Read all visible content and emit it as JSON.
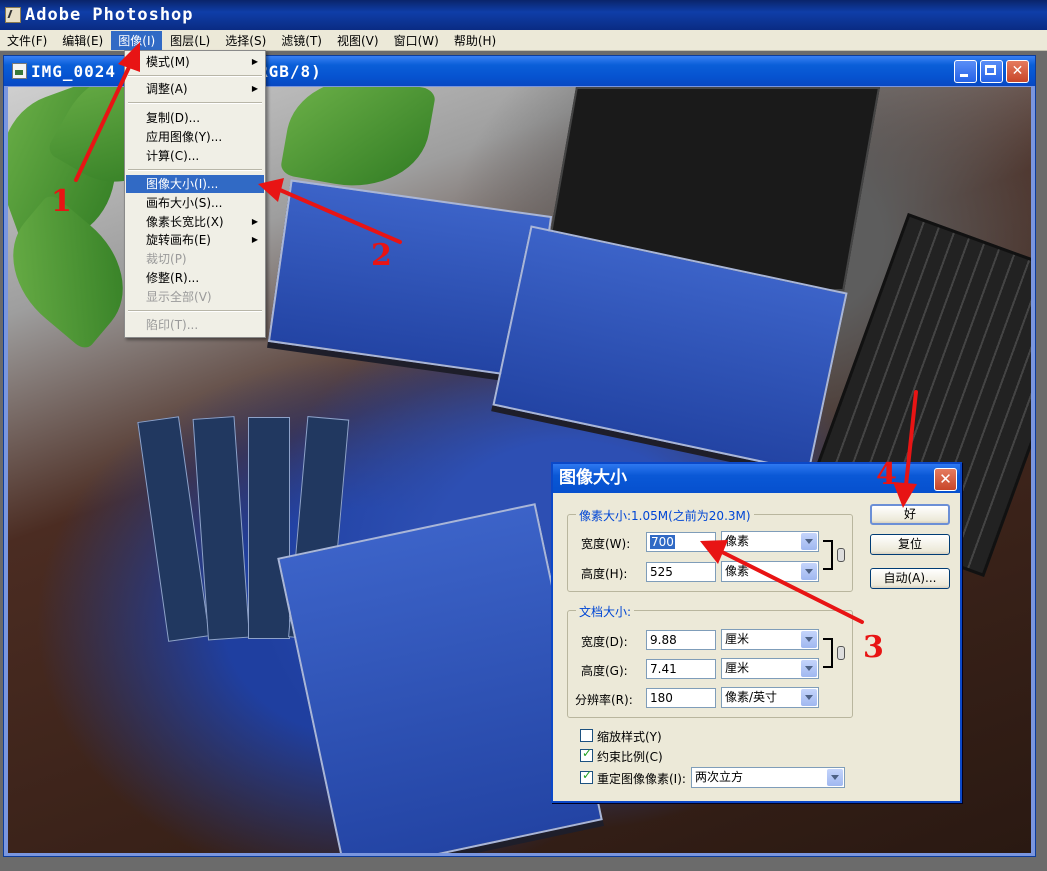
{
  "app": {
    "title": "Adobe Photoshop"
  },
  "menubar": {
    "items": [
      {
        "label": "文件",
        "key": "(F)"
      },
      {
        "label": "编辑",
        "key": "(E)"
      },
      {
        "label": "图像",
        "key": "(I)"
      },
      {
        "label": "图层",
        "key": "(L)"
      },
      {
        "label": "选择",
        "key": "(S)"
      },
      {
        "label": "滤镜",
        "key": "(T)"
      },
      {
        "label": "视图",
        "key": "(V)"
      },
      {
        "label": "窗口",
        "key": "(W)"
      },
      {
        "label": "帮助",
        "key": "(H)"
      }
    ]
  },
  "document": {
    "title_left": "IMG_0024",
    "title_right": "RGB/8)"
  },
  "image_menu": {
    "items": [
      {
        "label": "模式",
        "key": "(M)",
        "submenu": true
      },
      {
        "label": "调整",
        "key": "(A)",
        "submenu": true
      },
      {
        "label": "复制",
        "key": "(D)..."
      },
      {
        "label": "应用图像",
        "key": "(Y)..."
      },
      {
        "label": "计算",
        "key": "(C)..."
      },
      {
        "label": "图像大小",
        "key": "(I)...",
        "highlighted": true
      },
      {
        "label": "画布大小",
        "key": "(S)..."
      },
      {
        "label": "像素长宽比",
        "key": "(X)",
        "submenu": true
      },
      {
        "label": "旋转画布",
        "key": "(E)",
        "submenu": true
      },
      {
        "label": "裁切",
        "key": "(P)",
        "disabled": true
      },
      {
        "label": "修整",
        "key": "(R)..."
      },
      {
        "label": "显示全部",
        "key": "(V)",
        "disabled": true
      },
      {
        "label": "陷印",
        "key": "(T)...",
        "disabled": true
      }
    ]
  },
  "dialog": {
    "title": "图像大小",
    "pixel_group": "像素大小:1.05M(之前为20.3M)",
    "doc_group": "文档大小:",
    "pixel_width_label": "宽度(W):",
    "pixel_width_value": "700",
    "pixel_width_unit": "像素",
    "pixel_height_label": "高度(H):",
    "pixel_height_value": "525",
    "pixel_height_unit": "像素",
    "doc_width_label": "宽度(D):",
    "doc_width_value": "9.88",
    "doc_width_unit": "厘米",
    "doc_height_label": "高度(G):",
    "doc_height_value": "7.41",
    "doc_height_unit": "厘米",
    "resolution_label": "分辨率(R):",
    "resolution_value": "180",
    "resolution_unit": "像素/英寸",
    "scale_styles_label": "缩放样式(Y)",
    "constrain_label": "约束比例(C)",
    "resample_label": "重定图像像素(I):",
    "resample_value": "两次立方",
    "ok_label": "好",
    "reset_label": "复位",
    "auto_label": "自动(A)..."
  },
  "annotations": [
    "1",
    "2",
    "3",
    "4"
  ],
  "colors": {
    "annotation": "#e81414",
    "xp_blue": "#0a58d6",
    "menu_highlight": "#316ac5"
  }
}
